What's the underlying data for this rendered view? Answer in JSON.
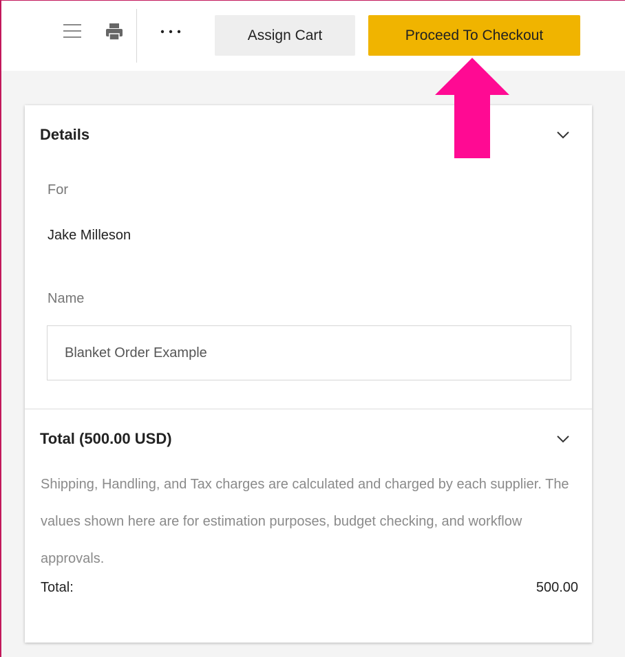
{
  "toolbar": {
    "menu_icon": "hamburger-menu-icon",
    "print_icon": "printer-icon",
    "more_icon": "more-options-icon",
    "assign_label": "Assign Cart",
    "checkout_label": "Proceed To Checkout"
  },
  "annotation": {
    "arrow_color": "#ff0a93"
  },
  "details": {
    "title": "Details",
    "for_label": "For",
    "for_value": "Jake Milleson",
    "name_label": "Name",
    "name_value": "Blanket Order Example"
  },
  "total": {
    "title": "Total (500.00 USD)",
    "note": "Shipping, Handling, and Tax charges are calculated and charged by each supplier. The values shown here are for estimation purposes, budget checking, and workflow approvals.",
    "total_label": "Total:",
    "total_value": "500.00"
  },
  "colors": {
    "accent": "#f0b400",
    "frame": "#c2185b"
  }
}
